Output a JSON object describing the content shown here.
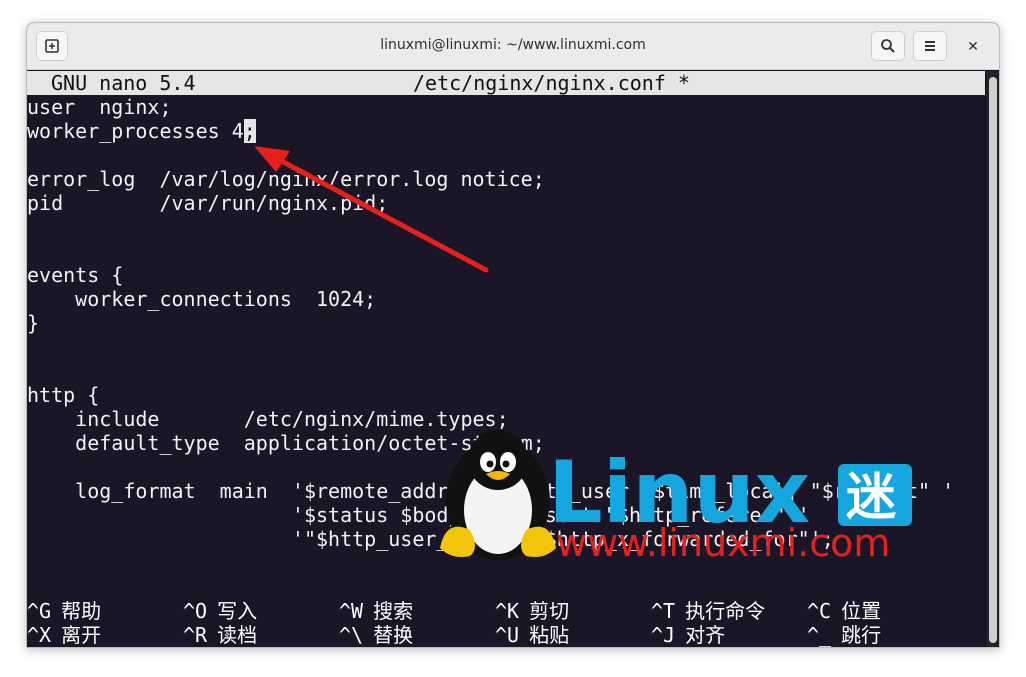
{
  "window": {
    "title": "linuxmi@linuxmi: ~/www.linuxmi.com",
    "close_glyph": "✕"
  },
  "nano": {
    "version": "GNU nano 5.4",
    "filename": "/etc/nginx/nginx.conf *"
  },
  "file_lines": [
    "user  nginx;",
    "worker_processes 4",
    "",
    "error_log  /var/log/nginx/error.log notice;",
    "pid        /var/run/nginx.pid;",
    "",
    "",
    "events {",
    "    worker_connections  1024;",
    "}",
    "",
    "",
    "http {",
    "    include       /etc/nginx/mime.types;",
    "    default_type  application/octet-stream;",
    "",
    "    log_format  main  '$remote_addr - $remote_user [$time_local] \"$request\" '",
    "                      '$status $body_bytes_sent \"$http_referer\" '",
    "                      '\"$http_user_agent\" \"$http_x_forwarded_for\"';"
  ],
  "cursor_char": ";",
  "shortcuts": [
    {
      "key": "^G",
      "label": "帮助"
    },
    {
      "key": "^O",
      "label": "写入"
    },
    {
      "key": "^W",
      "label": "搜索"
    },
    {
      "key": "^K",
      "label": "剪切"
    },
    {
      "key": "^T",
      "label": "执行命令"
    },
    {
      "key": "^C",
      "label": "位置"
    },
    {
      "key": "^X",
      "label": "离开"
    },
    {
      "key": "^R",
      "label": "读档"
    },
    {
      "key": "^\\",
      "label": "替换"
    },
    {
      "key": "^U",
      "label": "粘贴"
    },
    {
      "key": "^J",
      "label": "对齐"
    },
    {
      "key": "^_",
      "label": "跳行"
    }
  ],
  "watermark": {
    "brand": "Linux",
    "brand_cn": "迷",
    "url": "www.linuxmi.com"
  },
  "colors": {
    "terminal_bg": "#1b1528",
    "header_bg": "#e5e5e5",
    "arrow": "#e8201c",
    "watermark_blue": "#15a6e0",
    "watermark_red": "#e8201c"
  }
}
